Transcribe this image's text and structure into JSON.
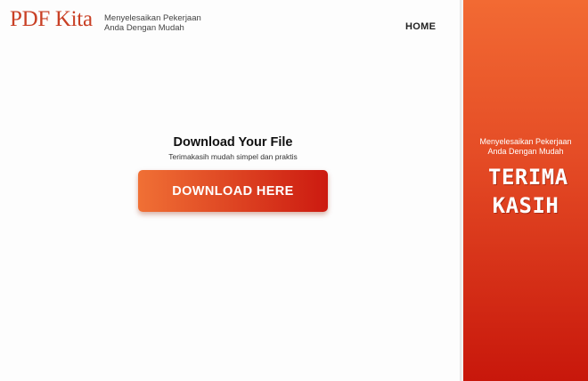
{
  "header": {
    "logo_text": "PDF Kita",
    "tagline": "Menyelesaikan Pekerjaan Anda Dengan Mudah",
    "nav_home": "HOME"
  },
  "main": {
    "title": "Download Your File",
    "subtitle": "Terimakasih mudah simpel dan praktis",
    "download_button": "DOWNLOAD HERE"
  },
  "side_panel": {
    "tagline": "Menyelesaikan Pekerjaan Anda Dengan Mudah",
    "thanks": "TERIMA KASIH"
  },
  "colors": {
    "brand": "#c94025",
    "accent_start": "#f07035",
    "accent_end": "#cc1a10"
  }
}
